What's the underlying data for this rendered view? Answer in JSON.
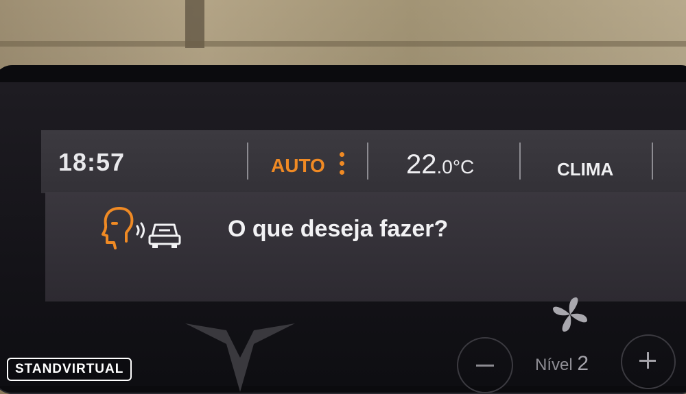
{
  "status_bar": {
    "time": "18:57",
    "auto_label": "AUTO",
    "temperature_main": "22",
    "temperature_decimal": ".0",
    "temperature_unit": "°C",
    "clima_label": "CLIMA"
  },
  "voice_assistant": {
    "prompt": "O que deseja fazer?"
  },
  "climate_controls": {
    "level_label": "Nível",
    "level_value": "2"
  },
  "watermark": {
    "text": "STANDVIRTUAL"
  },
  "colors": {
    "accent": "#f08a24",
    "text_primary": "#eeeef1",
    "panel": "#3a373e"
  },
  "icons": [
    "voice-head-icon",
    "car-sound-icon",
    "more-options-icon",
    "fan-icon",
    "cupra-logo",
    "minus-icon",
    "plus-icon"
  ]
}
